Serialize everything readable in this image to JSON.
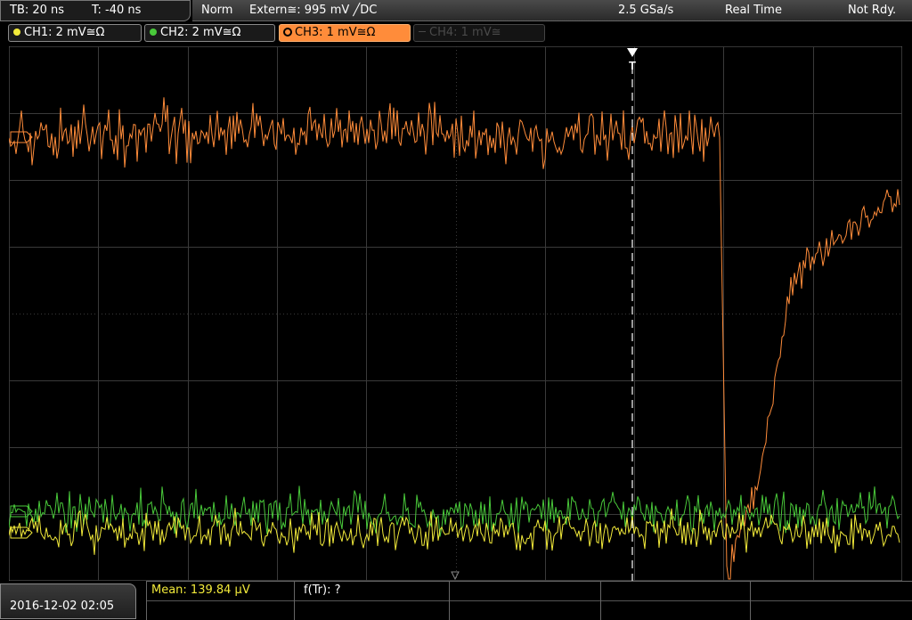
{
  "header": {
    "timebase": "TB: 20 ns",
    "trigger_time": "T: -40 ns",
    "mode": "Norm",
    "trigger_source": "Extern≅: 995 mV ╱DC",
    "sample_rate": "2.5 GSa/s",
    "acq_mode": "Real Time",
    "status": "Not Rdy."
  },
  "channels": [
    {
      "label": "CH1: 2 mV≅Ω",
      "color": "#f2ea3a",
      "state": "on"
    },
    {
      "label": "CH2: 2 mV≅Ω",
      "color": "#49c93a",
      "state": "on"
    },
    {
      "label": "CH3: 1 mV≅Ω",
      "color": "#ff8c3a",
      "state": "active"
    },
    {
      "label": "CH4: 1 mV≅",
      "color": "#4a4a4a",
      "state": "off"
    }
  ],
  "trigger_marker": "T",
  "bottom": {
    "datetime": "2016-12-02 02:05",
    "mean_label": "Mean: 139.84 µV",
    "ftr_label": "f(Tr): ?"
  },
  "colors": {
    "ch1": "#f2ea3a",
    "ch2": "#49c93a",
    "ch3": "#ff8c3a",
    "grid": "#3a3a3a",
    "trigger": "#ffffff"
  }
}
